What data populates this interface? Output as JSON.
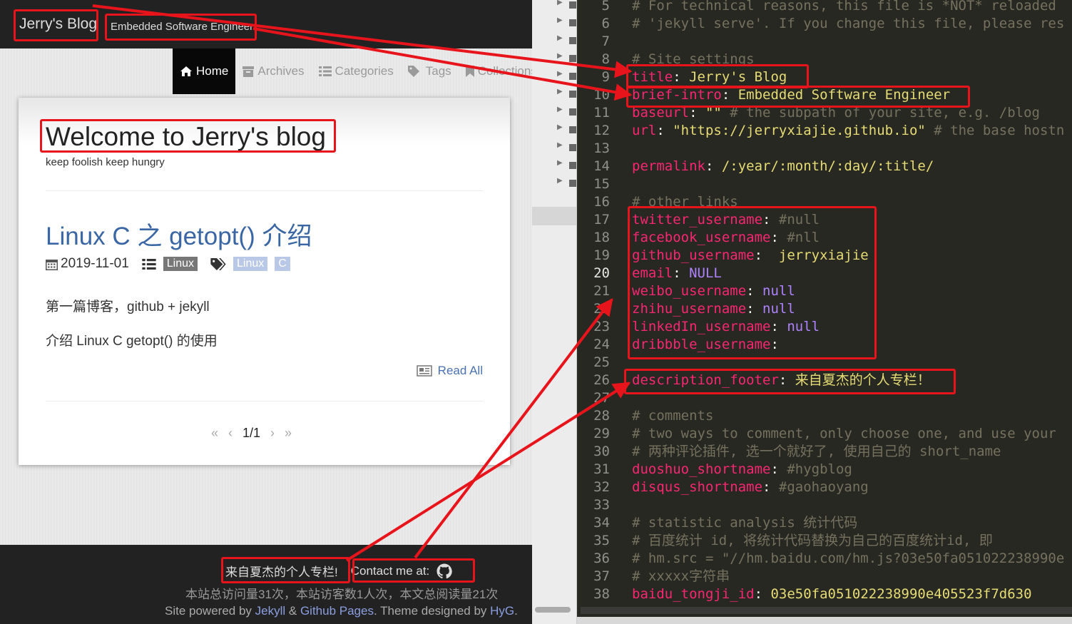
{
  "blog": {
    "site_title": "Jerry's Blog",
    "site_intro": "Embedded Software Engineer",
    "nav": [
      {
        "label": "Home",
        "icon": "home-icon",
        "active": true
      },
      {
        "label": "Archives",
        "icon": "archive-icon",
        "active": false
      },
      {
        "label": "Categories",
        "icon": "list-icon",
        "active": false
      },
      {
        "label": "Tags",
        "icon": "tags-icon",
        "active": false
      },
      {
        "label": "Collections",
        "icon": "bookmark-icon",
        "active": false
      }
    ],
    "welcome": "Welcome to Jerry's blog",
    "tagline": "keep foolish keep hungry",
    "post": {
      "title": "Linux C 之 getopt() 介绍",
      "date": "2019-11-01",
      "category": "Linux",
      "tags": [
        "Linux",
        "C"
      ],
      "paragraphs": [
        "第一篇博客，github + jekyll",
        "介绍 Linux C getopt() 的使用"
      ],
      "read_all": "Read All"
    },
    "pager": {
      "first": "«",
      "prev": "‹",
      "current": "1/1",
      "next": "›",
      "last": "»"
    },
    "footer": {
      "description": "来自夏杰的个人专栏!",
      "contact": "Contact me at:",
      "contact_icon": "github-icon",
      "stats": "本站总访问量31次，本站访客数1人次，本文总阅读量21次",
      "powered_prefix": "Site powered by ",
      "jekyll": "Jekyll",
      "amp": " & ",
      "github_pages": "Github Pages",
      "theme_text": ". Theme designed by ",
      "hyg": "HyG",
      "end": "."
    }
  },
  "editor": {
    "lines": [
      {
        "n": "5",
        "parts": [
          [
            "cm",
            "# For technical reasons, this file is *NOT* reloaded"
          ]
        ]
      },
      {
        "n": "6",
        "parts": [
          [
            "cm",
            "# 'jekyll serve'. If you change this file, please res"
          ]
        ]
      },
      {
        "n": "7",
        "parts": []
      },
      {
        "n": "8",
        "parts": [
          [
            "cm",
            "# Site settings"
          ]
        ]
      },
      {
        "n": "9",
        "parts": [
          [
            "k",
            "title"
          ],
          [
            "p",
            ": "
          ],
          [
            "s",
            "Jerry's Blog"
          ]
        ]
      },
      {
        "n": "10",
        "parts": [
          [
            "k",
            "brief-intro"
          ],
          [
            "p",
            ": "
          ],
          [
            "s",
            "Embedded Software Engineer"
          ]
        ]
      },
      {
        "n": "11",
        "parts": [
          [
            "k",
            "baseurl"
          ],
          [
            "p",
            ": "
          ],
          [
            "s",
            "\"\""
          ],
          [
            "cm",
            " # the subpath of your site, e.g. /blog"
          ]
        ]
      },
      {
        "n": "12",
        "parts": [
          [
            "k",
            "url"
          ],
          [
            "p",
            ": "
          ],
          [
            "s",
            "\"https://jerryxiajie.github.io\""
          ],
          [
            "cm",
            " # the base hostn"
          ]
        ]
      },
      {
        "n": "13",
        "parts": []
      },
      {
        "n": "14",
        "parts": [
          [
            "k",
            "permalink"
          ],
          [
            "p",
            ": "
          ],
          [
            "s",
            "/:year/:month/:day/:title/"
          ]
        ]
      },
      {
        "n": "15",
        "parts": []
      },
      {
        "n": "16",
        "parts": [
          [
            "cm",
            "# other links"
          ]
        ]
      },
      {
        "n": "17",
        "parts": [
          [
            "k",
            "twitter_username"
          ],
          [
            "p",
            ": "
          ],
          [
            "cm",
            "#null"
          ]
        ]
      },
      {
        "n": "18",
        "parts": [
          [
            "k",
            "facebook_username"
          ],
          [
            "p",
            ": "
          ],
          [
            "cm",
            "#nll"
          ]
        ]
      },
      {
        "n": "19",
        "parts": [
          [
            "k",
            "github_username"
          ],
          [
            "p",
            ":  "
          ],
          [
            "s",
            "jerryxiajie"
          ]
        ]
      },
      {
        "n": "20",
        "parts": [
          [
            "k",
            "email"
          ],
          [
            "p",
            ": "
          ],
          [
            "n",
            "NULL"
          ]
        ]
      },
      {
        "n": "21",
        "parts": [
          [
            "k",
            "weibo_username"
          ],
          [
            "p",
            ": "
          ],
          [
            "n",
            "null"
          ]
        ]
      },
      {
        "n": "22",
        "parts": [
          [
            "k",
            "zhihu_username"
          ],
          [
            "p",
            ": "
          ],
          [
            "n",
            "null"
          ]
        ]
      },
      {
        "n": "23",
        "parts": [
          [
            "k",
            "linkedIn_username"
          ],
          [
            "p",
            ": "
          ],
          [
            "n",
            "null"
          ]
        ]
      },
      {
        "n": "24",
        "parts": [
          [
            "k",
            "dribbble_username"
          ],
          [
            "p",
            ":"
          ]
        ]
      },
      {
        "n": "25",
        "parts": []
      },
      {
        "n": "26",
        "parts": [
          [
            "k",
            "description_footer"
          ],
          [
            "p",
            ": "
          ],
          [
            "s",
            "来自夏杰的个人专栏！"
          ]
        ]
      },
      {
        "n": "27",
        "parts": []
      },
      {
        "n": "28",
        "parts": [
          [
            "cm",
            "# comments"
          ]
        ]
      },
      {
        "n": "29",
        "parts": [
          [
            "cm",
            "# two ways to comment, only choose one, and use your"
          ]
        ]
      },
      {
        "n": "30",
        "parts": [
          [
            "cm",
            "# 两种评论插件, 选一个就好了, 使用自己的 short_name"
          ]
        ]
      },
      {
        "n": "31",
        "parts": [
          [
            "k",
            "duoshuo_shortname"
          ],
          [
            "p",
            ": "
          ],
          [
            "cm",
            "#hygblog"
          ]
        ]
      },
      {
        "n": "32",
        "parts": [
          [
            "k",
            "disqus_shortname"
          ],
          [
            "p",
            ": "
          ],
          [
            "cm",
            "#gaohaoyang"
          ]
        ]
      },
      {
        "n": "33",
        "parts": []
      },
      {
        "n": "34",
        "parts": [
          [
            "cm",
            "# statistic analysis 统计代码"
          ]
        ]
      },
      {
        "n": "35",
        "parts": [
          [
            "cm",
            "# 百度统计 id, 将统计代码替换为自己的百度统计id, 即"
          ]
        ]
      },
      {
        "n": "36",
        "parts": [
          [
            "cm",
            "# hm.src = \"//hm.baidu.com/hm.js?03e50fa051022238990e"
          ]
        ]
      },
      {
        "n": "37",
        "parts": [
          [
            "cm",
            "# xxxxx字符串"
          ]
        ]
      },
      {
        "n": "38",
        "parts": [
          [
            "k",
            "baidu_tongji_id"
          ],
          [
            "p",
            ": "
          ],
          [
            "s",
            "03e50fa051022238990e405523f7d630"
          ]
        ]
      }
    ],
    "current_line": "20"
  }
}
